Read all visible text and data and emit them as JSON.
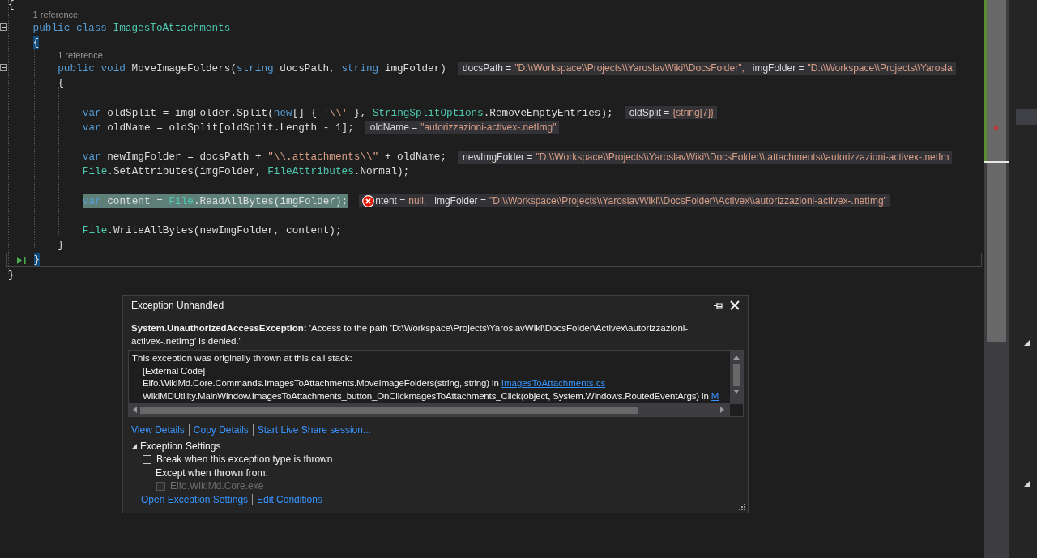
{
  "editor": {
    "lines": [
      {
        "kind": "code",
        "tokens": [
          {
            "kind": "plain",
            "t": "{"
          }
        ],
        "children": [
          {
            "kind": "codelens",
            "text": "1 reference"
          },
          {
            "kind": "code",
            "collapsible": true,
            "tokens": [
              {
                "kind": "kw",
                "t": "public"
              },
              {
                "kind": "kw",
                "t": " class"
              },
              {
                "kind": "type",
                "t": " ImagesToAttachments"
              }
            ]
          },
          {
            "kind": "code",
            "tokens": [
              {
                "kind": "brace_match",
                "t": "{"
              }
            ],
            "children": [
              {
                "kind": "codelens",
                "text": "1 reference"
              },
              {
                "kind": "code",
                "collapsible": true,
                "tokens": [
                  {
                    "kind": "kw",
                    "t": "public"
                  },
                  {
                    "kind": "kw",
                    "t": " void"
                  },
                  {
                    "kind": "plain",
                    "t": " MoveImageFolders("
                  },
                  {
                    "kind": "kw",
                    "t": "string"
                  },
                  {
                    "kind": "plain",
                    "t": " docsPath, "
                  },
                  {
                    "kind": "kw",
                    "t": "string"
                  },
                  {
                    "kind": "plain",
                    "t": " imgFolder)"
                  }
                ],
                "datatips": [
                  {
                    "kind": "value",
                    "name": "docsPath =",
                    "value": "\"D:\\\\Workspace\\\\Projects\\\\YaroslavWiki\\\\DocsFolder\","
                  },
                  {
                    "kind": "value",
                    "name": "imgFolder =",
                    "value": "\"D:\\\\Workspace\\\\Projects\\\\Yarosla"
                  }
                ]
              },
              {
                "kind": "code",
                "tokens": [
                  {
                    "kind": "plain",
                    "t": "{"
                  }
                ],
                "children": [
                  {
                    "kind": "blank"
                  },
                  {
                    "kind": "code",
                    "tokens": [
                      {
                        "kind": "kw",
                        "t": "var"
                      },
                      {
                        "kind": "plain",
                        "t": " oldSplit = imgFolder.Split("
                      },
                      {
                        "kind": "kw",
                        "t": "new"
                      },
                      {
                        "kind": "plain",
                        "t": "[] { "
                      },
                      {
                        "kind": "str",
                        "t": "'\\\\'"
                      },
                      {
                        "kind": "plain",
                        "t": " }, "
                      },
                      {
                        "kind": "type",
                        "t": "StringSplitOptions"
                      },
                      {
                        "kind": "plain",
                        "t": ".RemoveEmptyEntries);"
                      }
                    ],
                    "datatips": [
                      {
                        "kind": "value",
                        "name": "oldSplit =",
                        "value": "{string[7]}"
                      }
                    ]
                  },
                  {
                    "kind": "code",
                    "tokens": [
                      {
                        "kind": "kw",
                        "t": "var"
                      },
                      {
                        "kind": "plain",
                        "t": " oldName = oldSplit[oldSplit.Length - 1];"
                      }
                    ],
                    "datatips": [
                      {
                        "kind": "value",
                        "name": "oldName =",
                        "value": "\"autorizzazioni-activex-.netImg\""
                      }
                    ]
                  },
                  {
                    "kind": "blank"
                  },
                  {
                    "kind": "code",
                    "tokens": [
                      {
                        "kind": "kw",
                        "t": "var"
                      },
                      {
                        "kind": "plain",
                        "t": " newImgFolder = docsPath + "
                      },
                      {
                        "kind": "str",
                        "t": "\"\\\\.attachments\\\\\""
                      },
                      {
                        "kind": "plain",
                        "t": " + oldName;"
                      }
                    ],
                    "datatips": [
                      {
                        "kind": "value",
                        "name": "newImgFolder =",
                        "value": "\"D:\\\\Workspace\\\\Projects\\\\YaroslavWiki\\\\DocsFolder\\\\.attachments\\\\autorizzazioni-activex-.netIm"
                      }
                    ]
                  },
                  {
                    "kind": "code",
                    "tokens": [
                      {
                        "kind": "type",
                        "t": "File"
                      },
                      {
                        "kind": "plain",
                        "t": ".SetAttributes(imgFolder, "
                      },
                      {
                        "kind": "type",
                        "t": "FileAttributes"
                      },
                      {
                        "kind": "plain",
                        "t": ".Normal);"
                      }
                    ]
                  },
                  {
                    "kind": "blank"
                  },
                  {
                    "kind": "code",
                    "highlight": true,
                    "tokens": [
                      {
                        "kind": "kw",
                        "t": "var"
                      },
                      {
                        "kind": "plain",
                        "t": " content = "
                      },
                      {
                        "kind": "type",
                        "t": "File"
                      },
                      {
                        "kind": "plain",
                        "t": ".ReadAllBytes(imgFolder);"
                      }
                    ],
                    "datatips": [
                      {
                        "kind": "error",
                        "name": "ntent =",
                        "value": "null,"
                      },
                      {
                        "kind": "value",
                        "name": "imgFolder =",
                        "value": "\"D:\\\\Workspace\\\\Projects\\\\YaroslavWiki\\\\DocsFolder\\\\Activex\\\\autorizzazioni-activex-.netImg\""
                      }
                    ]
                  },
                  {
                    "kind": "blank"
                  },
                  {
                    "kind": "code",
                    "tokens": [
                      {
                        "kind": "type",
                        "t": "File"
                      },
                      {
                        "kind": "plain",
                        "t": ".WriteAllBytes(newImgFolder, content);"
                      }
                    ]
                  }
                ]
              },
              {
                "kind": "code",
                "tokens": [
                  {
                    "kind": "plain",
                    "t": "}"
                  }
                ]
              }
            ]
          },
          {
            "kind": "code",
            "current": true,
            "tokens": [
              {
                "kind": "brace_match",
                "t": "}"
              }
            ]
          }
        ]
      },
      {
        "kind": "code",
        "tokens": [
          {
            "kind": "plain",
            "t": "}"
          }
        ]
      }
    ]
  },
  "exception_dialog": {
    "title": "Exception Unhandled",
    "message_type": "System.UnauthorizedAccessException:",
    "message": "'Access to the path 'D:\\Workspace\\Projects\\YaroslavWiki\\DocsFolder\\Activex\\autorizzazioni-activex-.netImg' is denied.'",
    "call_stack": {
      "heading": "This exception was originally thrown at this call stack:",
      "frames": [
        {
          "text": "[External Code]"
        },
        {
          "text": "Elfo.WikiMd.Core.Commands.ImagesToAttachments.MoveImageFolders(string, string) in ",
          "link": "ImagesToAttachments.cs"
        },
        {
          "text": "WikiMDUtility.MainWindow.ImagesToAttachments_button_OnClickmagesToAttachments_Click(object, System.Windows.RoutedEventArgs) in ",
          "link": "M"
        }
      ]
    },
    "links": [
      "View Details",
      "Copy Details",
      "Start Live Share session..."
    ],
    "settings": {
      "title": "Exception Settings",
      "expanded": true,
      "break_option": {
        "label": "Break when this exception type is thrown",
        "checked": false
      },
      "except_label": "Except when thrown from:",
      "modules": [
        {
          "label": "Elfo.WikiMd.Core.exe",
          "checked": false,
          "disabled": true
        }
      ],
      "links": [
        "Open Exception Settings",
        "Edit Conditions"
      ]
    }
  }
}
